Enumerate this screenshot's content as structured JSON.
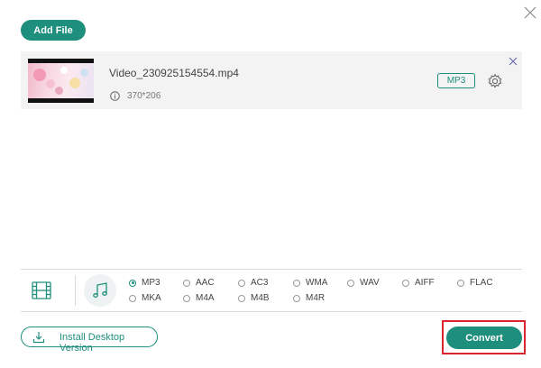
{
  "toolbar": {
    "add_file_label": "Add File"
  },
  "file": {
    "name": "Video_230925154554.mp4",
    "resolution": "370*206",
    "output_format": "MP3"
  },
  "formats": {
    "selected": "MP3",
    "audio_options": [
      "MP3",
      "AAC",
      "AC3",
      "WMA",
      "WAV",
      "AIFF",
      "FLAC",
      "MKA",
      "M4A",
      "M4B",
      "M4R"
    ]
  },
  "footer": {
    "install_label": "Install Desktop Version",
    "convert_label": "Convert"
  },
  "colors": {
    "accent": "#1f8f7d",
    "highlight_border": "#d9252d",
    "row_background": "#f3f3f3"
  },
  "icons": [
    "close-icon",
    "info-icon",
    "gear-icon",
    "film-icon",
    "music-note-icon",
    "download-icon"
  ]
}
